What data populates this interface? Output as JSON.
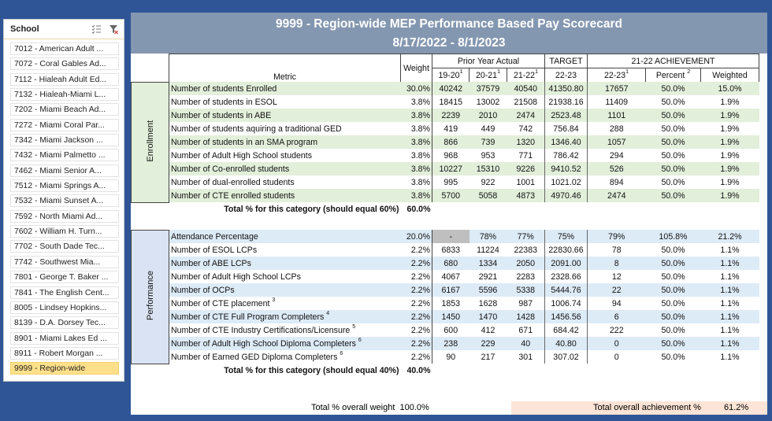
{
  "slicer": {
    "title": "School",
    "icons": [
      "multi-select-icon",
      "clear-filter-icon"
    ],
    "items": [
      {
        "label": "7012 - American Adult ...",
        "selected": false
      },
      {
        "label": "7072 - Coral Gables Ad...",
        "selected": false
      },
      {
        "label": "7112 - Hialeah Adult Ed...",
        "selected": false
      },
      {
        "label": "7132 - Hialeah-Miami L...",
        "selected": false
      },
      {
        "label": "7202 - Miami Beach Ad...",
        "selected": false
      },
      {
        "label": "7272 - Miami Coral Par...",
        "selected": false
      },
      {
        "label": "7342 - Miami Jackson ...",
        "selected": false
      },
      {
        "label": "7432 - Miami Palmetto ...",
        "selected": false
      },
      {
        "label": "7462 - Miami Senior A...",
        "selected": false
      },
      {
        "label": "7512 - Miami Springs A...",
        "selected": false
      },
      {
        "label": "7532 - Miami Sunset A...",
        "selected": false
      },
      {
        "label": "7592 - North Miami Ad...",
        "selected": false
      },
      {
        "label": "7602 - William H. Turn...",
        "selected": false
      },
      {
        "label": "7702 - South Dade Tec...",
        "selected": false
      },
      {
        "label": "7742 - Southwest Mia...",
        "selected": false
      },
      {
        "label": "7801 - George T. Baker ...",
        "selected": false
      },
      {
        "label": "7841 - The English Cent...",
        "selected": false
      },
      {
        "label": "8005 - Lindsey Hopkins...",
        "selected": false
      },
      {
        "label": "8139 - D.A. Dorsey Tec...",
        "selected": false
      },
      {
        "label": "8901 - Miami Lakes Ed ...",
        "selected": false
      },
      {
        "label": "8911 - Robert Morgan ...",
        "selected": false
      },
      {
        "label": "9999 - Region-wide",
        "selected": true
      }
    ]
  },
  "report": {
    "title": "9999 - Region-wide MEP Performance Based Pay Scorecard",
    "date_range": "8/17/2022 - 8/1/2023",
    "headers": {
      "metric": "Metric",
      "weight": "Weight",
      "prior_year": "Prior Year Actual",
      "target": "TARGET",
      "achievement": "21-22 ACHIEVEMENT",
      "y1": "19-20",
      "y1_sup": "1",
      "y2": "20-21",
      "y2_sup": "1",
      "y3": "21-22",
      "y3_sup": "1",
      "target_year": "22-23",
      "ach_year": "22-23",
      "ach_year_sup": "1",
      "percent": "Percent ",
      "percent_sup": "2",
      "weighted": "Weighted"
    },
    "enrollment": {
      "label": "Enrollment",
      "rows": [
        {
          "metric": "Number of students Enrolled",
          "sup": "",
          "weight": "30.0%",
          "y1": "40242",
          "y2": "37579",
          "y3": "40540",
          "target": "41350.80",
          "ach": "17657",
          "percent": "50.0%",
          "weighted": "15.0%"
        },
        {
          "metric": "Number of students in ESOL",
          "sup": "",
          "weight": "3.8%",
          "y1": "18415",
          "y2": "13002",
          "y3": "21508",
          "target": "21938.16",
          "ach": "11409",
          "percent": "50.0%",
          "weighted": "1.9%"
        },
        {
          "metric": "Number of students in ABE",
          "sup": "",
          "weight": "3.8%",
          "y1": "2239",
          "y2": "2010",
          "y3": "2474",
          "target": "2523.48",
          "ach": "1101",
          "percent": "50.0%",
          "weighted": "1.9%"
        },
        {
          "metric": "Number of students aquiring a traditional GED",
          "sup": "",
          "weight": "3.8%",
          "y1": "419",
          "y2": "449",
          "y3": "742",
          "target": "756.84",
          "ach": "288",
          "percent": "50.0%",
          "weighted": "1.9%"
        },
        {
          "metric": "Number of students in an SMA program",
          "sup": "",
          "weight": "3.8%",
          "y1": "866",
          "y2": "739",
          "y3": "1320",
          "target": "1346.40",
          "ach": "1057",
          "percent": "50.0%",
          "weighted": "1.9%"
        },
        {
          "metric": "Number of Adult High School students",
          "sup": "",
          "weight": "3.8%",
          "y1": "968",
          "y2": "953",
          "y3": "771",
          "target": "786.42",
          "ach": "294",
          "percent": "50.0%",
          "weighted": "1.9%"
        },
        {
          "metric": "Number of Co-enrolled students",
          "sup": "",
          "weight": "3.8%",
          "y1": "10227",
          "y2": "15310",
          "y3": "9226",
          "target": "9410.52",
          "ach": "526",
          "percent": "50.0%",
          "weighted": "1.9%"
        },
        {
          "metric": "Number of dual-enrolled students",
          "sup": "",
          "weight": "3.8%",
          "y1": "995",
          "y2": "922",
          "y3": "1001",
          "target": "1021.02",
          "ach": "894",
          "percent": "50.0%",
          "weighted": "1.9%"
        },
        {
          "metric": "Number of CTE enrolled students",
          "sup": "",
          "weight": "3.8%",
          "y1": "5700",
          "y2": "5058",
          "y3": "4873",
          "target": "4970.46",
          "ach": "2474",
          "percent": "50.0%",
          "weighted": "1.9%"
        }
      ],
      "total_label": "Total % for this category (should equal 60%)",
      "total_value": "60.0%"
    },
    "performance": {
      "label": "Performance",
      "rows": [
        {
          "metric": "Attendance Percentage",
          "sup": "",
          "weight": "20.0%",
          "y1": "-",
          "y2": "78%",
          "y3": "77%",
          "target": "75%",
          "ach": "79%",
          "percent": "105.8%",
          "weighted": "21.2%"
        },
        {
          "metric": "Number of ESOL LCPs",
          "sup": "",
          "weight": "2.2%",
          "y1": "6833",
          "y2": "11224",
          "y3": "22383",
          "target": "22830.66",
          "ach": "78",
          "percent": "50.0%",
          "weighted": "1.1%"
        },
        {
          "metric": "Number of ABE LCPs",
          "sup": "",
          "weight": "2.2%",
          "y1": "680",
          "y2": "1334",
          "y3": "2050",
          "target": "2091.00",
          "ach": "8",
          "percent": "50.0%",
          "weighted": "1.1%"
        },
        {
          "metric": "Number of Adult High School LCPs",
          "sup": "",
          "weight": "2.2%",
          "y1": "4067",
          "y2": "2921",
          "y3": "2283",
          "target": "2328.66",
          "ach": "12",
          "percent": "50.0%",
          "weighted": "1.1%"
        },
        {
          "metric": "Number of OCPs",
          "sup": "",
          "weight": "2.2%",
          "y1": "6167",
          "y2": "5596",
          "y3": "5338",
          "target": "5444.76",
          "ach": "22",
          "percent": "50.0%",
          "weighted": "1.1%"
        },
        {
          "metric": "Number of CTE placement ",
          "sup": "3",
          "weight": "2.2%",
          "y1": "1853",
          "y2": "1628",
          "y3": "987",
          "target": "1006.74",
          "ach": "94",
          "percent": "50.0%",
          "weighted": "1.1%"
        },
        {
          "metric": "Number of CTE Full Program Completers ",
          "sup": "4",
          "weight": "2.2%",
          "y1": "1450",
          "y2": "1470",
          "y3": "1428",
          "target": "1456.56",
          "ach": "6",
          "percent": "50.0%",
          "weighted": "1.1%"
        },
        {
          "metric": "Number of CTE Industry Certifications/Licensure ",
          "sup": "5",
          "weight": "2.2%",
          "y1": "600",
          "y2": "412",
          "y3": "671",
          "target": "684.42",
          "ach": "222",
          "percent": "50.0%",
          "weighted": "1.1%"
        },
        {
          "metric": "Number of Adult High School Diploma Completers ",
          "sup": "6",
          "weight": "2.2%",
          "y1": "238",
          "y2": "229",
          "y3": "40",
          "target": "40.80",
          "ach": "0",
          "percent": "50.0%",
          "weighted": "1.1%"
        },
        {
          "metric": "Number of Earned GED Diploma Completers ",
          "sup": "6",
          "weight": "2.2%",
          "y1": "90",
          "y2": "217",
          "y3": "301",
          "target": "307.02",
          "ach": "0",
          "percent": "50.0%",
          "weighted": "1.1%"
        }
      ],
      "total_label": "Total % for this category (should equal 40%)",
      "total_value": "40.0%"
    },
    "footer": {
      "overall_weight_label": "Total % overall weight",
      "overall_weight_value": "100.0%",
      "overall_achievement_label": "Total overall achievement %",
      "overall_achievement_value": "61.2%"
    },
    "colors": {
      "background": "#2f5597",
      "title_band": "#8497b0",
      "enrollment_row": "#e2efda",
      "performance_row": "#ddebf7",
      "selected_item": "#ffe08a",
      "achievement_total": "#fce4d6"
    }
  }
}
